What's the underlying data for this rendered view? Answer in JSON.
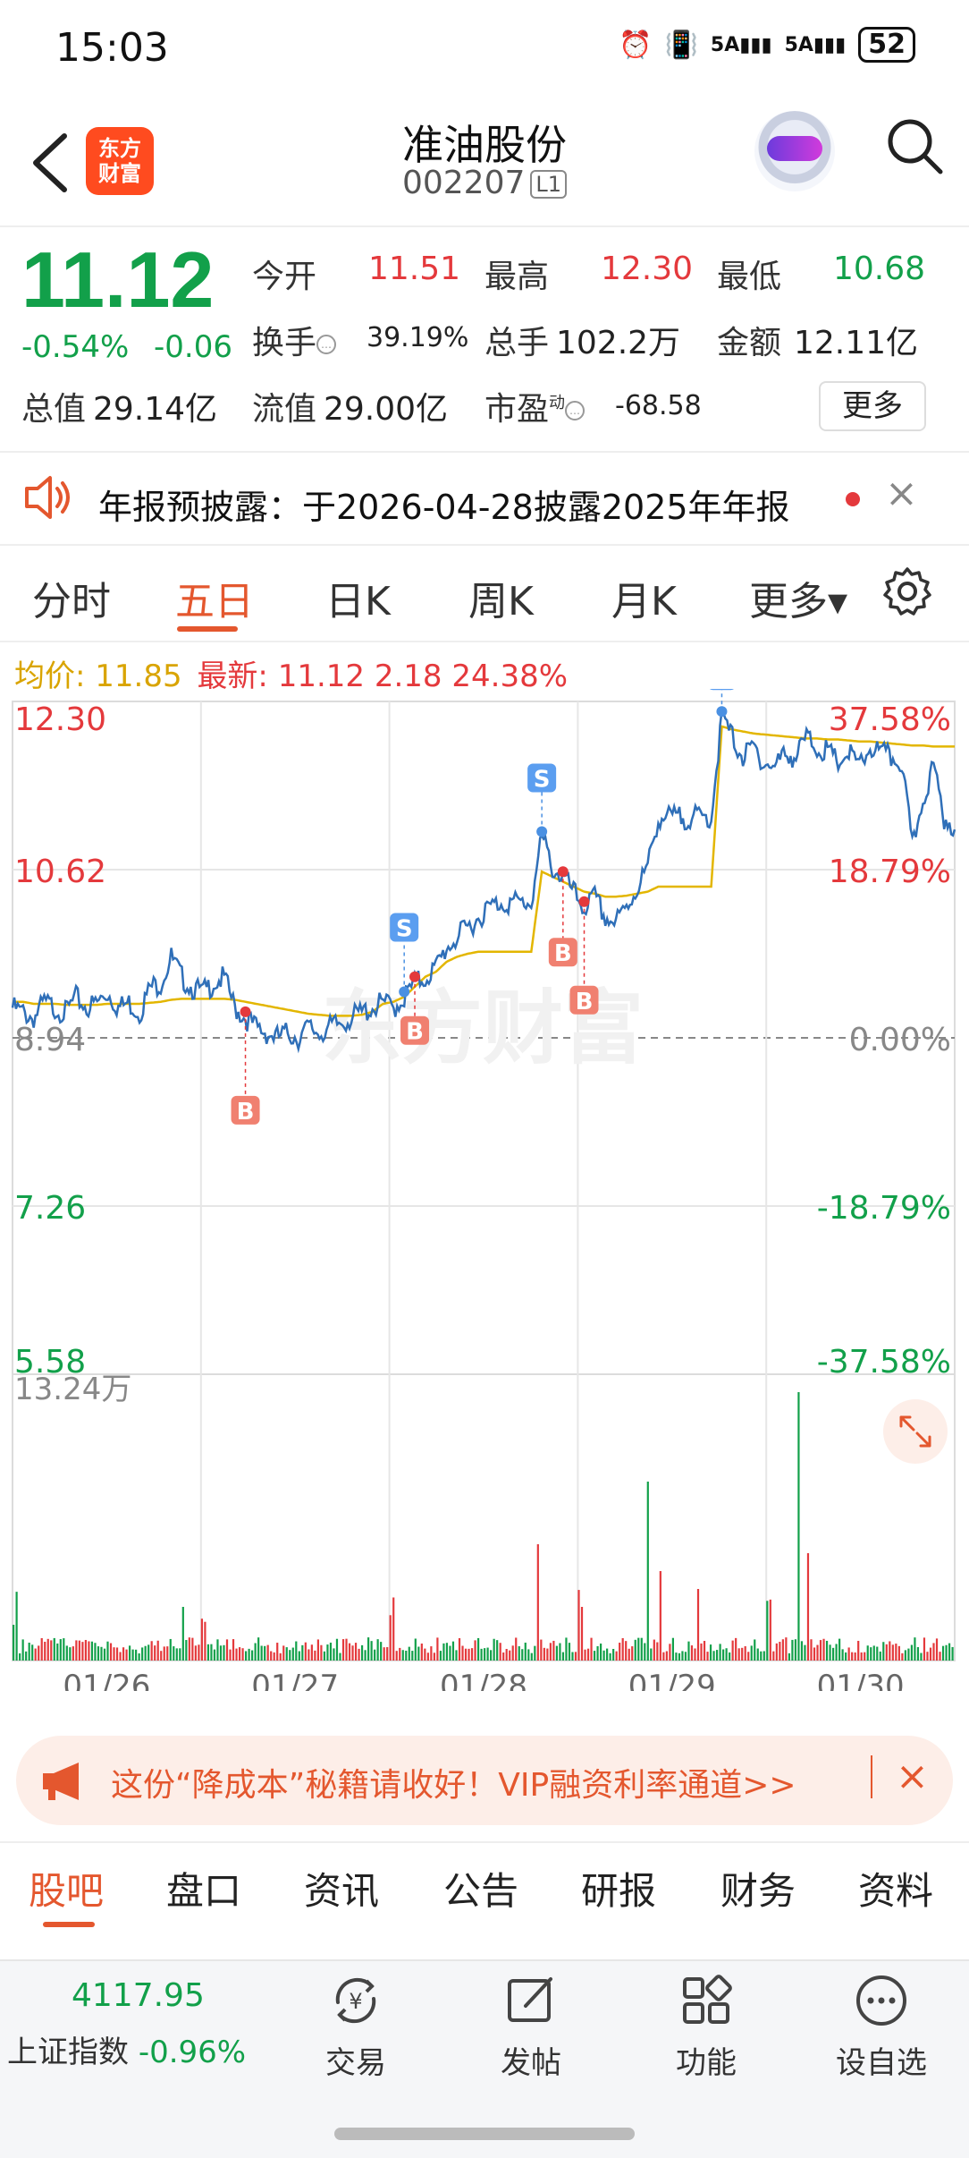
{
  "status_bar": {
    "time": "15:03",
    "battery": "52",
    "signal1": "5A",
    "signal2": "5A"
  },
  "header": {
    "logo_line1": "东方",
    "logo_line2": "财富",
    "name": "准油股份",
    "code": "002207",
    "level": "L1"
  },
  "quote": {
    "price": "11.12",
    "change_pct": "-0.54%",
    "change": "-0.06",
    "open_label": "今开",
    "open": "11.51",
    "high_label": "最高",
    "high": "12.30",
    "low_label": "最低",
    "low": "10.68",
    "turnover_label": "换手",
    "turnover": "39.19%",
    "volume_label": "总手",
    "volume": "102.2万",
    "amount_label": "金额",
    "amount": "12.11亿",
    "mktcap_label": "总值",
    "mktcap": "29.14亿",
    "float_label": "流值",
    "float": "29.00亿",
    "pe_label": "市盈",
    "pe_sup": "动",
    "pe": "-68.58",
    "more": "更多"
  },
  "notice": {
    "text": "年报预披露：于2026-04-28披露2025年年报",
    "close": "×"
  },
  "chart_tabs": {
    "t1": "分时",
    "t2": "五日",
    "t3": "日K",
    "t4": "周K",
    "t5": "月K",
    "t6": "更多▾"
  },
  "legend": {
    "avg_label": "均价:",
    "avg": "11.85",
    "last_label": "最新:",
    "last": "11.12 2.18 24.38%"
  },
  "chart_data": {
    "type": "line",
    "x": [
      "01/26",
      "01/27",
      "01/28",
      "01/29",
      "01/30"
    ],
    "y_ticks_left": [
      "12.30",
      "10.62",
      "8.94",
      "7.26",
      "5.58"
    ],
    "y_ticks_right": [
      "37.58%",
      "18.79%",
      "0.00%",
      "-18.79%",
      "-37.58%"
    ],
    "ylim": [
      5.58,
      12.3
    ],
    "prev_close": 8.94,
    "volume_max_label": "13.24万",
    "series": [
      {
        "values": [
          9.3,
          9.25,
          9.2,
          9.35,
          9.3,
          9.25,
          9.4,
          9.3,
          9.35,
          9.45,
          9.3,
          9.35,
          9.25,
          9.5,
          9.55,
          9.8,
          9.6,
          9.5,
          9.45,
          9.55,
          9.6,
          9.3,
          9.2,
          9.1,
          9.05,
          9.0,
          9.05,
          9.0,
          9.1,
          9.05,
          9.1,
          9.15,
          9.2,
          9.25,
          9.3,
          9.35,
          9.3,
          9.4,
          9.55,
          9.6,
          9.7,
          9.9,
          10.0,
          10.1,
          10.2,
          10.3,
          10.35,
          10.35,
          10.35,
          10.35,
          11.0,
          10.7,
          10.6,
          10.45,
          10.3,
          10.4,
          10.2,
          10.15,
          10.3,
          10.5,
          10.7,
          11.2,
          11.2,
          11.2,
          11.2,
          11.2,
          11.2,
          12.2,
          12.0,
          11.8,
          11.9,
          11.75,
          11.7,
          11.85,
          11.8,
          12.0,
          11.9,
          11.85,
          11.75,
          11.85,
          11.7,
          11.9,
          11.85,
          11.8,
          11.75,
          10.9,
          11.4,
          11.7,
          11.2,
          11.12
        ]
      },
      {
        "values": [
          9.3,
          9.3,
          9.28,
          9.28,
          9.28,
          9.27,
          9.27,
          9.27,
          9.27,
          9.28,
          9.28,
          9.28,
          9.28,
          9.29,
          9.3,
          9.32,
          9.33,
          9.33,
          9.33,
          9.33,
          9.33,
          9.32,
          9.3,
          9.28,
          9.26,
          9.24,
          9.22,
          9.2,
          9.18,
          9.17,
          9.16,
          9.16,
          9.16,
          9.17,
          9.2,
          9.28,
          9.3,
          9.35,
          9.45,
          9.55,
          9.6,
          9.7,
          9.75,
          9.78,
          9.8,
          9.8,
          9.8,
          9.8,
          9.8,
          9.8,
          10.6,
          10.55,
          10.5,
          10.45,
          10.4,
          10.38,
          10.35,
          10.35,
          10.36,
          10.38,
          10.4,
          10.45,
          10.45,
          10.45,
          10.45,
          10.45,
          10.45,
          12.05,
          12.02,
          12.0,
          11.98,
          11.97,
          11.96,
          11.95,
          11.94,
          11.93,
          11.93,
          11.92,
          11.92,
          11.91,
          11.9,
          11.9,
          11.89,
          11.88,
          11.87,
          11.86,
          11.86,
          11.85,
          11.85,
          11.85
        ]
      }
    ],
    "markers": [
      {
        "type": "B",
        "x_index": 22,
        "day": "01/27"
      },
      {
        "type": "S",
        "x_index": 37,
        "day": "01/28"
      },
      {
        "type": "B",
        "x_index": 38,
        "day": "01/28"
      },
      {
        "type": "S",
        "x_index": 50,
        "day": "01/29"
      },
      {
        "type": "B",
        "x_index": 52,
        "day": "01/29"
      },
      {
        "type": "B",
        "x_index": 54,
        "day": "01/29"
      },
      {
        "type": "S",
        "x_index": 67,
        "day": "01/30"
      }
    ]
  },
  "promo": {
    "text": "这份“降成本”秘籍请收好！VIP融资利率通道>>",
    "close": "×"
  },
  "bottom_tabs": {
    "b1": "股吧",
    "b2": "盘口",
    "b3": "资讯",
    "b4": "公告",
    "b5": "研报",
    "b6": "财务",
    "b7": "资料"
  },
  "footer": {
    "index_value": "4117.95",
    "index_name": "上证指数",
    "index_change": "-0.96%",
    "trade": "交易",
    "post": "发帖",
    "functions": "功能",
    "watchlist": "设自选"
  },
  "colors": {
    "up": "#e4393c",
    "down": "#12a04a",
    "accent": "#e4572e",
    "avg_line": "#e3b600",
    "price_line": "#2f6fb8"
  }
}
